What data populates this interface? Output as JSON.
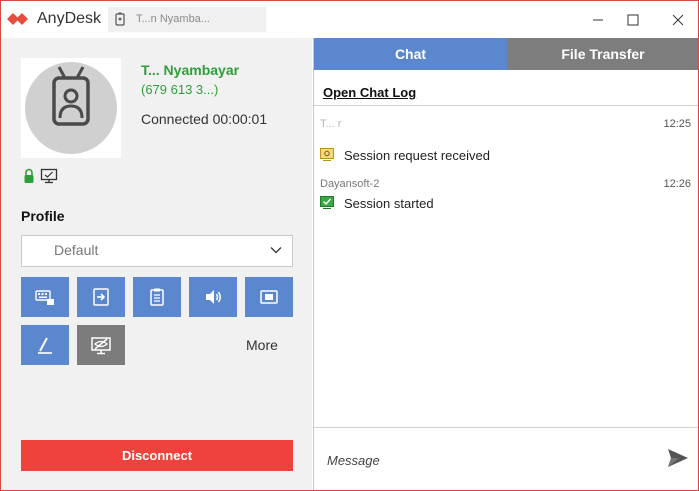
{
  "titlebar": {
    "app_name": "AnyDesk",
    "address_text": "T...n Nyamba...",
    "colors": {
      "brand": "#e84c3d"
    }
  },
  "remote": {
    "name": "T... Nyambayar",
    "id": "(679 613 3...)",
    "status": "Connected 00:00:01"
  },
  "profile": {
    "label": "Profile",
    "selected": "Default"
  },
  "toolbar": {
    "buttons": [
      {
        "icon": "keyboard-icon"
      },
      {
        "icon": "switch-sides-icon"
      },
      {
        "icon": "clipboard-icon"
      },
      {
        "icon": "speaker-icon"
      },
      {
        "icon": "video-icon"
      },
      {
        "icon": "whiteboard-pen-icon"
      },
      {
        "icon": "privacy-mode-icon"
      }
    ],
    "more_label": "More"
  },
  "disconnect_label": "Disconnect",
  "tabs": {
    "chat": "Chat",
    "file_transfer": "File Transfer"
  },
  "chat": {
    "open_log_label": "Open Chat Log",
    "messages": [
      {
        "sender": "T... r",
        "time": "12:25",
        "text": "Session request received",
        "icon": "session-request-icon"
      },
      {
        "sender": "Dayansoft-2",
        "time": "12:26",
        "text": "Session started",
        "icon": "session-started-icon"
      }
    ],
    "input_placeholder": "Message"
  }
}
